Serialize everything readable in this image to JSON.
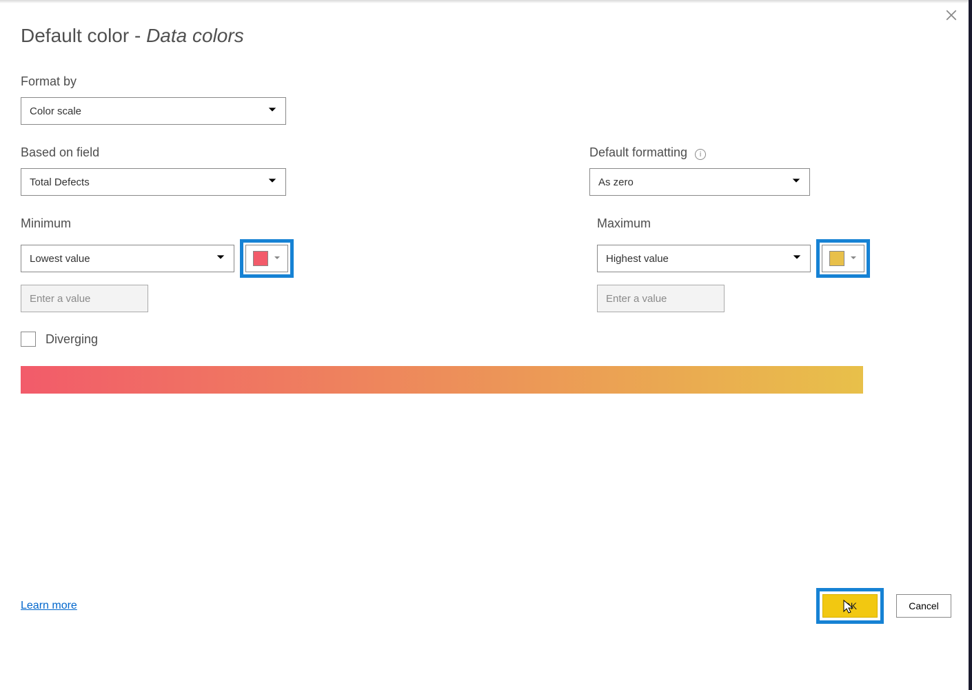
{
  "title": {
    "main": "Default color",
    "sub": "Data colors"
  },
  "format_by": {
    "label": "Format by",
    "value": "Color scale"
  },
  "based_on": {
    "label": "Based on field",
    "value": "Total Defects"
  },
  "default_formatting": {
    "label": "Default formatting",
    "value": "As zero"
  },
  "minimum": {
    "label": "Minimum",
    "dropdown": "Lowest value",
    "placeholder": "Enter a value",
    "color": "#f25b6a"
  },
  "maximum": {
    "label": "Maximum",
    "dropdown": "Highest value",
    "placeholder": "Enter a value",
    "color": "#e8c04a"
  },
  "diverging": {
    "label": "Diverging",
    "checked": false
  },
  "gradient": {
    "from": "#f25b6a",
    "to": "#e8c04a"
  },
  "footer": {
    "learn_more": "Learn more",
    "ok": "OK",
    "cancel": "Cancel"
  },
  "icons": {
    "close": "close-icon",
    "chevron_down": "chevron-down-icon",
    "info": "info-icon"
  }
}
